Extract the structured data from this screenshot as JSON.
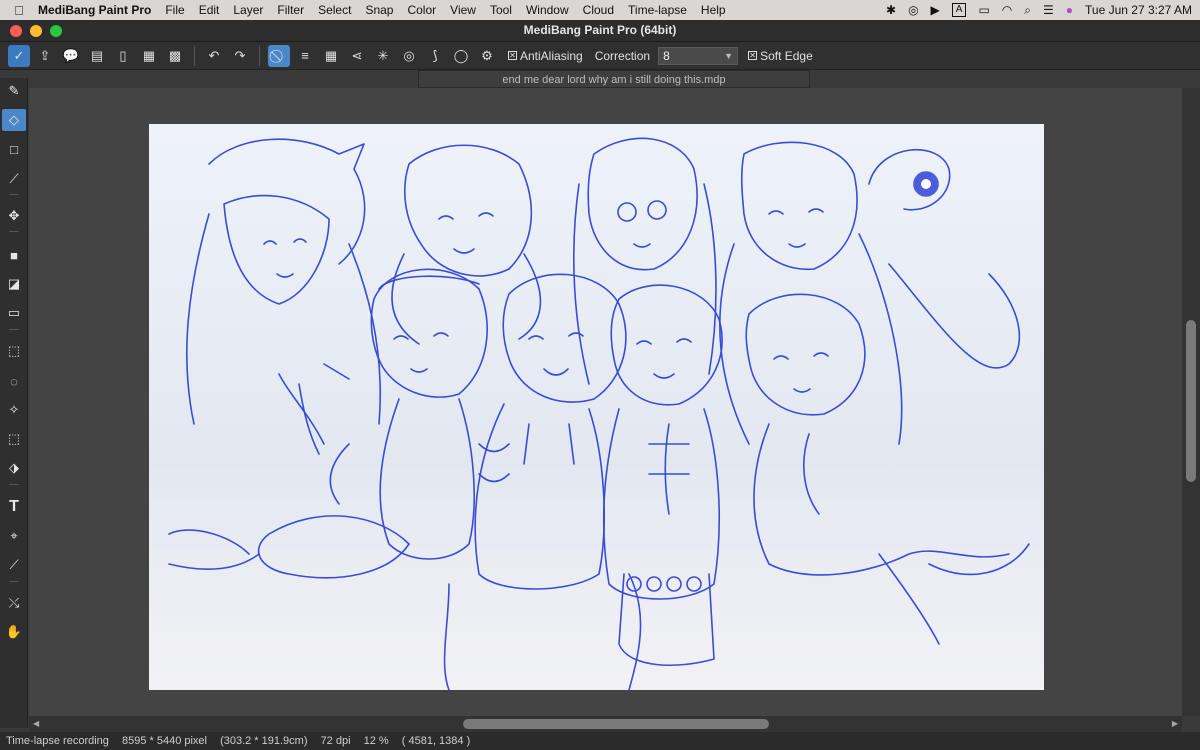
{
  "menubar": {
    "app_name": "MediBang Paint Pro",
    "items": [
      "File",
      "Edit",
      "Layer",
      "Filter",
      "Select",
      "Snap",
      "Color",
      "View",
      "Tool",
      "Window",
      "Cloud",
      "Time-lapse",
      "Help"
    ],
    "clock": "Tue Jun 27  3:27 AM",
    "input_indicator": "A"
  },
  "window": {
    "title": "MediBang Paint Pro (64bit)",
    "document_tab": "end me dear lord why am i still doing this.mdp"
  },
  "toolbar": {
    "antialiasing_label": "AntiAliasing",
    "correction_label": "Correction",
    "correction_value": "8",
    "soft_edge_label": "Soft Edge",
    "checkbox_mark": "✕"
  },
  "status": {
    "recording": "Time-lapse recording",
    "pixel_size": "8595 * 5440 pixel",
    "cm_size": "(303.2 * 191.9cm)",
    "dpi": "72 dpi",
    "zoom": "12 %",
    "cursor": "( 4581, 1384 )"
  },
  "colors": {
    "accent": "#4b88c9",
    "sketch_line": "#2b3fd6",
    "canvas_bg": "#f4f6fb"
  }
}
